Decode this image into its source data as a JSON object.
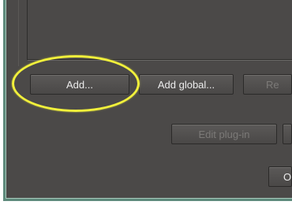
{
  "buttons": {
    "add": "Add...",
    "add_global": "Add global...",
    "remove": "Re",
    "edit_plugin": "Edit plug-in",
    "right_partial": "",
    "ok": "O"
  },
  "colors": {
    "window_bg": "#4b4948",
    "frame_accent": "#5e8a7c",
    "highlight": "#f1f03b",
    "button_text": "#ececec",
    "disabled_text": "#7c7a78"
  }
}
